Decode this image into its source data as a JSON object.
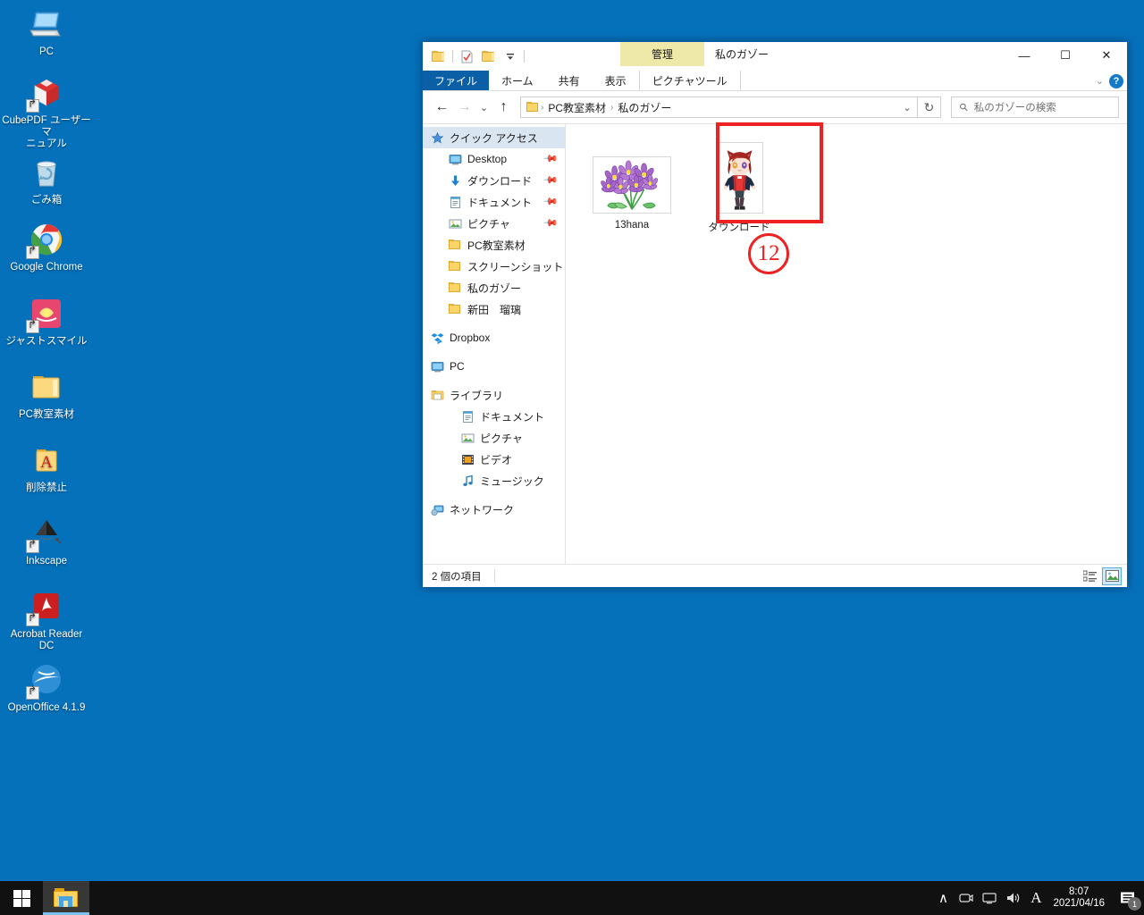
{
  "desktop": {
    "icons": [
      {
        "label": "PC",
        "icon": "computer-icon",
        "shortcut": false
      },
      {
        "label": "CubePDF ユーザーマ\nニュアル",
        "icon": "cubepdf-icon",
        "shortcut": true
      },
      {
        "label": "ごみ箱",
        "icon": "recycle-bin-icon",
        "shortcut": false
      },
      {
        "label": "Google Chrome",
        "icon": "chrome-icon",
        "shortcut": true
      },
      {
        "label": "ジャストスマイル",
        "icon": "justsmile-icon",
        "shortcut": true
      },
      {
        "label": "PC教室素材",
        "icon": "folder-icon",
        "shortcut": false
      },
      {
        "label": "削除禁止",
        "icon": "pdf-folder-icon",
        "shortcut": false
      },
      {
        "label": "Inkscape",
        "icon": "inkscape-icon",
        "shortcut": true
      },
      {
        "label": "Acrobat Reader DC",
        "icon": "acrobat-icon",
        "shortcut": true
      },
      {
        "label": "OpenOffice 4.1.9",
        "icon": "openoffice-icon",
        "shortcut": true
      }
    ]
  },
  "taskbar": {
    "start_label": "スタート",
    "explorer_label": "エクスプローラー",
    "tray": {
      "chevron": "∧",
      "icons": [
        "camera-icon",
        "display-icon",
        "volume-icon"
      ],
      "ime": "A",
      "time": "8:07",
      "date": "2021/04/16",
      "notification_count": "1"
    }
  },
  "window": {
    "title": "私のガゾー",
    "contextual_tab": "管理",
    "quick_access": [
      {
        "name": "folder-icon",
        "label": "フォルダー"
      },
      {
        "name": "properties-icon",
        "label": "プロパティ"
      },
      {
        "name": "new-folder-icon",
        "label": "新しいフォルダー"
      },
      {
        "name": "customize-dropdown-icon",
        "label": "▾"
      }
    ],
    "controls": {
      "minimize": "—",
      "maximize": "☐",
      "close": "✕"
    },
    "ribbon_collapse": "⌄",
    "help": "?",
    "tabs": [
      {
        "label": "ファイル",
        "active": true
      },
      {
        "label": "ホーム",
        "active": false
      },
      {
        "label": "共有",
        "active": false
      },
      {
        "label": "表示",
        "active": false
      },
      {
        "label": "ピクチャツール",
        "active": false
      }
    ],
    "nav": {
      "back": "←",
      "forward": "→",
      "recent": "⌄",
      "up": "↑"
    },
    "breadcrumb": [
      "PC教室素材",
      "私のガゾー"
    ],
    "breadcrumb_sep": "›",
    "address_dropdown": "⌄",
    "refresh": "↻",
    "search": {
      "placeholder": "私のガゾーの検索",
      "value": "",
      "icon": "search-icon"
    }
  },
  "sidebar": {
    "items": [
      {
        "label": "クイック アクセス",
        "icon": "star-icon",
        "level": 0,
        "header": true,
        "pin": false,
        "gap": false
      },
      {
        "label": "Desktop",
        "icon": "desktop-icon",
        "level": 1,
        "header": false,
        "pin": true,
        "gap": false
      },
      {
        "label": "ダウンロード",
        "icon": "download-icon",
        "level": 1,
        "header": false,
        "pin": true,
        "gap": false
      },
      {
        "label": "ドキュメント",
        "icon": "document-icon",
        "level": 1,
        "header": false,
        "pin": true,
        "gap": false
      },
      {
        "label": "ピクチャ",
        "icon": "picture-icon",
        "level": 1,
        "header": false,
        "pin": true,
        "gap": false
      },
      {
        "label": "PC教室素材",
        "icon": "folder-icon",
        "level": 1,
        "header": false,
        "pin": false,
        "gap": false
      },
      {
        "label": "スクリーンショット",
        "icon": "folder-icon",
        "level": 1,
        "header": false,
        "pin": false,
        "gap": false
      },
      {
        "label": "私のガゾー",
        "icon": "folder-icon",
        "level": 1,
        "header": false,
        "pin": false,
        "gap": false
      },
      {
        "label": "新田　瑠璃",
        "icon": "folder-icon",
        "level": 1,
        "header": false,
        "pin": false,
        "gap": false
      },
      {
        "label": "Dropbox",
        "icon": "dropbox-icon",
        "level": 0,
        "header": false,
        "pin": false,
        "gap": true
      },
      {
        "label": "PC",
        "icon": "computer-icon",
        "level": 0,
        "header": false,
        "pin": false,
        "gap": true
      },
      {
        "label": "ライブラリ",
        "icon": "library-icon",
        "level": 0,
        "header": false,
        "pin": false,
        "gap": true
      },
      {
        "label": "ドキュメント",
        "icon": "document-icon",
        "level": 2,
        "header": false,
        "pin": false,
        "gap": false
      },
      {
        "label": "ピクチャ",
        "icon": "picture-icon",
        "level": 2,
        "header": false,
        "pin": false,
        "gap": false
      },
      {
        "label": "ビデオ",
        "icon": "video-icon",
        "level": 2,
        "header": false,
        "pin": false,
        "gap": false
      },
      {
        "label": "ミュージック",
        "icon": "music-icon",
        "level": 2,
        "header": false,
        "pin": false,
        "gap": false
      },
      {
        "label": "ネットワーク",
        "icon": "network-icon",
        "level": 0,
        "header": false,
        "pin": false,
        "gap": true
      }
    ]
  },
  "content": {
    "files": [
      {
        "name": "13hana",
        "thumb": "flower-image",
        "selected": true
      },
      {
        "name": "ダウンロード",
        "thumb": "character-image",
        "selected": false
      }
    ],
    "annotation": {
      "number": "⑫",
      "number_plain": "12",
      "color": "#ee2222"
    }
  },
  "statusbar": {
    "item_count": "2 個の項目",
    "views": [
      {
        "name": "details-view-button",
        "active": false
      },
      {
        "name": "large-icons-view-button",
        "active": true
      }
    ]
  },
  "colors": {
    "desktop_bg": "#0571bb",
    "taskbar_bg": "#111111",
    "accent": "#0b5fa5",
    "contextual_tab": "#eee8a9",
    "annotation_red": "#ee2222"
  }
}
